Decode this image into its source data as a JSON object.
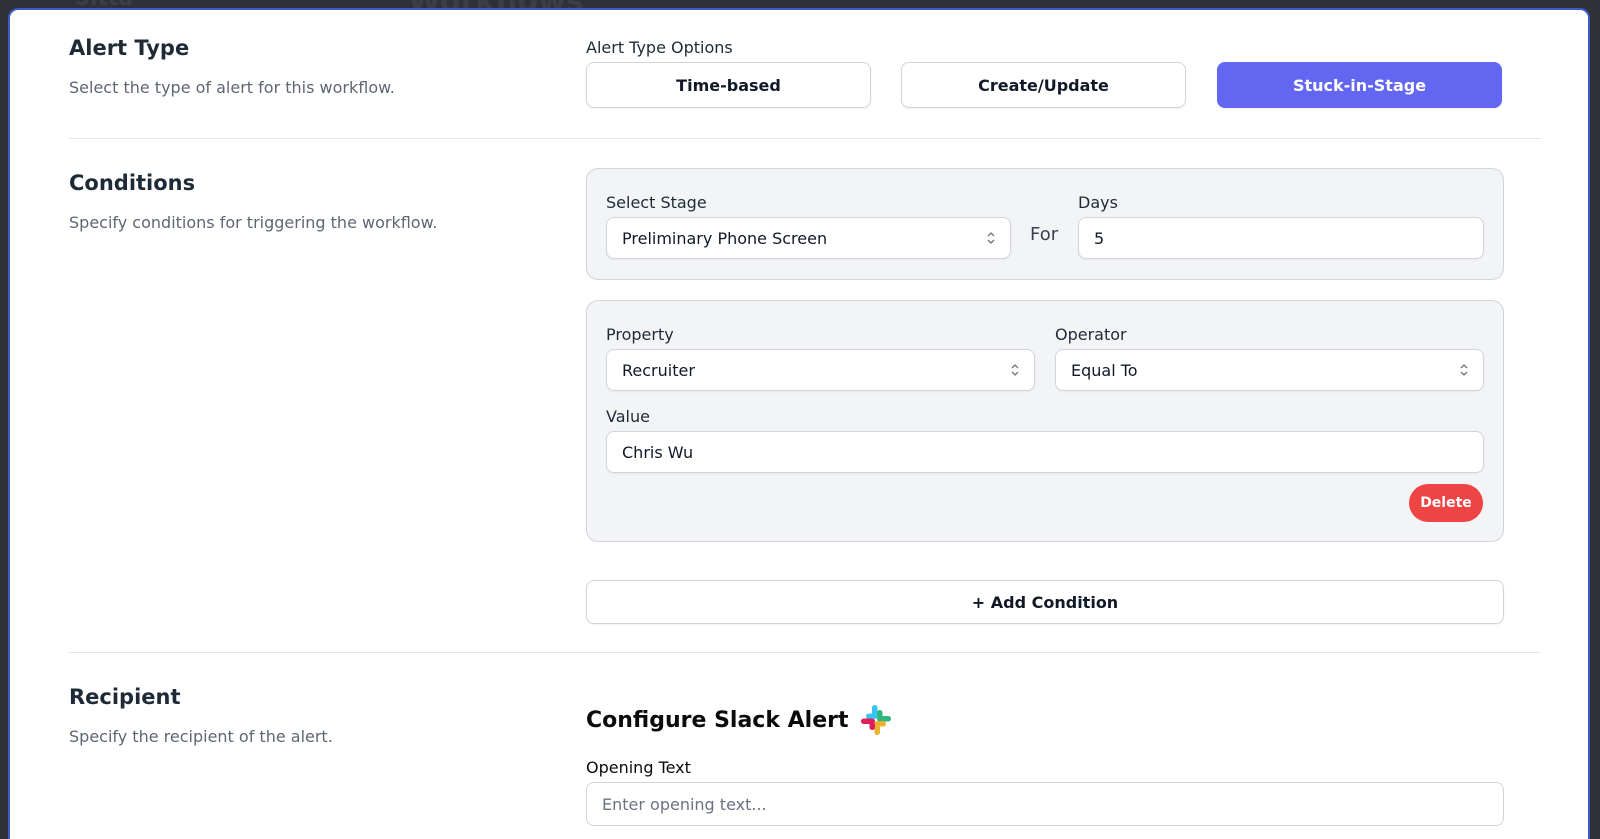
{
  "background": {
    "brand_text": "Sitta",
    "page_title": "Workflows"
  },
  "alert_type": {
    "title": "Alert Type",
    "description": "Select the type of alert for this workflow.",
    "options_label": "Alert Type Options",
    "options": [
      {
        "label": "Time-based",
        "selected": false
      },
      {
        "label": "Create/Update",
        "selected": false
      },
      {
        "label": "Stuck-in-Stage",
        "selected": true
      }
    ],
    "accent_color": "#6366f1"
  },
  "conditions": {
    "title": "Conditions",
    "description": "Specify conditions for triggering the workflow.",
    "stage": {
      "label": "Select Stage",
      "value": "Preliminary Phone Screen",
      "for_label": "For",
      "days_label": "Days",
      "days_value": "5"
    },
    "condition": {
      "property_label": "Property",
      "property_value": "Recruiter",
      "operator_label": "Operator",
      "operator_value": "Equal To",
      "value_label": "Value",
      "value_value": "Chris Wu",
      "delete_label": "Delete"
    },
    "add_condition_label": "+ Add Condition"
  },
  "recipient": {
    "title": "Recipient",
    "description": "Specify the recipient of the alert.",
    "slack_title": "Configure Slack Alert",
    "opening_text_label": "Opening Text",
    "opening_text_placeholder": "Enter opening text...",
    "opening_text_value": ""
  },
  "icons": {
    "select_chevron": "chevron-up-down-icon",
    "slack": "slack-logo-icon"
  }
}
